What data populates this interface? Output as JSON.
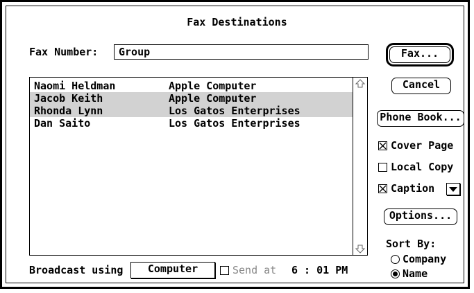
{
  "dialog": {
    "title": "Fax Destinations"
  },
  "fax_number": {
    "label": "Fax Number:",
    "value": "Group"
  },
  "buttons": {
    "fax": "Fax...",
    "cancel": "Cancel",
    "phone_book": "Phone Book...",
    "options": "Options..."
  },
  "destinations": {
    "rows": [
      {
        "name": "Naomi Heldman",
        "company": "Apple Computer",
        "selected": false
      },
      {
        "name": "Jacob Keith",
        "company": "Apple Computer",
        "selected": true
      },
      {
        "name": "Rhonda Lynn",
        "company": "Los Gatos Enterprises",
        "selected": true
      },
      {
        "name": "Dan Saito",
        "company": "Los Gatos Enterprises",
        "selected": false
      }
    ]
  },
  "checkboxes": {
    "cover_page": {
      "label": "Cover Page",
      "checked": true
    },
    "local_copy": {
      "label": "Local Copy",
      "checked": false
    },
    "caption": {
      "label": "Caption",
      "checked": true
    }
  },
  "sort_by": {
    "label": "Sort By:",
    "options": [
      {
        "label": "Company",
        "selected": false
      },
      {
        "label": "Name",
        "selected": true
      }
    ]
  },
  "broadcast": {
    "label": "Broadcast using",
    "value": "Computer",
    "send_at_label": "Send at",
    "send_at_checked": false,
    "time": "6 : 01 PM"
  },
  "colors": {
    "selection": "#d2d2d2",
    "disabled_text": "#888888"
  }
}
